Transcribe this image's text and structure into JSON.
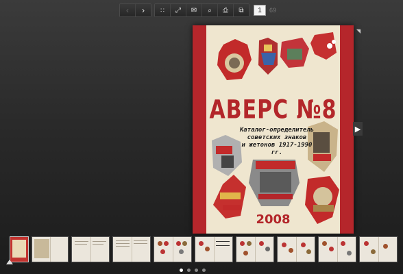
{
  "toolbar": {
    "prev_icon": "chevron-left-icon",
    "next_icon": "chevron-right-icon",
    "grid_icon": "grid-icon",
    "fullscreen_icon": "expand-icon",
    "mail_icon": "mail-icon",
    "search_icon": "search-icon",
    "print_icon": "print-icon",
    "pages_icon": "pages-icon",
    "current_page": "1",
    "total_pages": "69"
  },
  "cover": {
    "title": "АВЕРС №8",
    "subtitle_line1": "Каталог-определитель",
    "subtitle_line2": "советских знаков",
    "subtitle_line3": "и жетонов 1917-1990 гг.",
    "year": "2008",
    "accent": "#b3262a",
    "background": "#efe6cf"
  },
  "thumbnails": {
    "count": 10,
    "active_index": 0
  },
  "pager_dots": {
    "count": 4,
    "active": 0
  }
}
